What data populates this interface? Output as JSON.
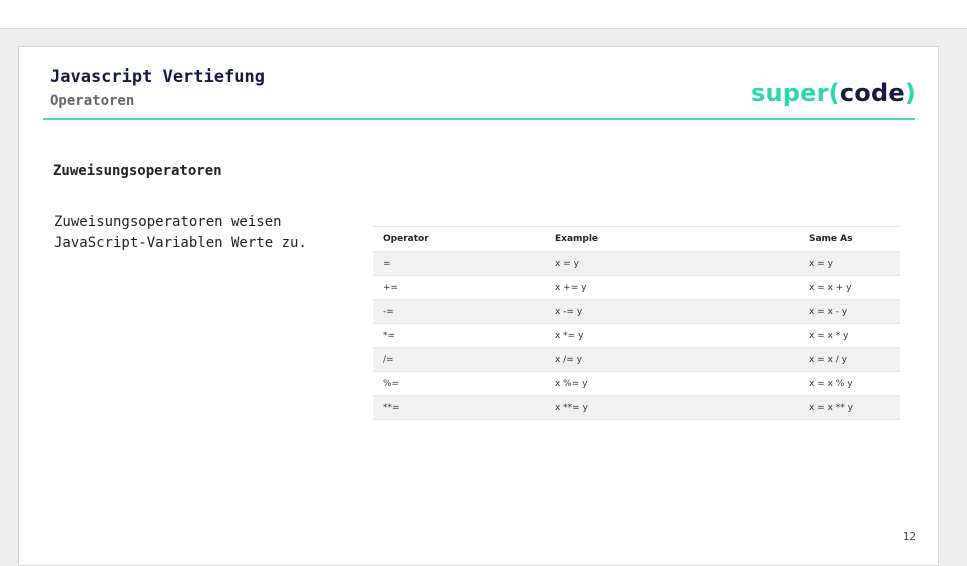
{
  "header": {
    "title": "Javascript Vertiefung",
    "subtitle": "Operatoren",
    "logo": {
      "prefix": "super",
      "open_paren": "(",
      "word": "code",
      "close_paren": ")"
    }
  },
  "content": {
    "section_title": "Zuweisungsoperatoren",
    "description": "Zuweisungsoperatoren weisen JavaScript-Variablen Werte zu.",
    "table": {
      "headers": [
        "Operator",
        "Example",
        "Same As"
      ],
      "rows": [
        [
          "=",
          "x = y",
          "x = y"
        ],
        [
          "+=",
          "x += y",
          "x = x + y"
        ],
        [
          "-=",
          "x -= y",
          "x = x - y"
        ],
        [
          "*=",
          "x *= y",
          "x = x * y"
        ],
        [
          "/=",
          "x /= y",
          "x = x / y"
        ],
        [
          "%=",
          "x %= y",
          "x = x % y"
        ],
        [
          "**=",
          "x **= y",
          "x = x ** y"
        ]
      ]
    }
  },
  "footer": {
    "page_number": "12"
  },
  "colors": {
    "accent": "#47d8c0",
    "brand_dark": "#151a45",
    "brand_green": "#2fd6ad"
  }
}
